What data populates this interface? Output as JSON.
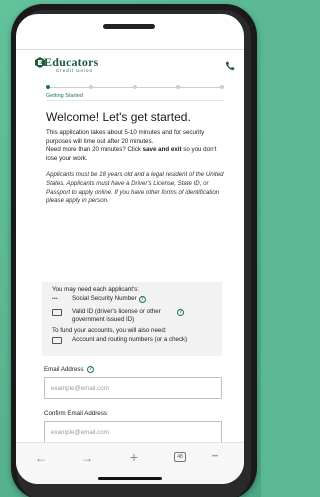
{
  "brand": {
    "name": "Educators",
    "subname": "Credit Union",
    "accent": "#1c7a4a",
    "dark_green": "#1c5c3a",
    "background": "#5cb894"
  },
  "header": {
    "phone_icon": "phone-icon"
  },
  "progress": {
    "step_label": "Getting Started",
    "total_steps": 5,
    "current_step": 1
  },
  "main": {
    "title": "Welcome! Let's get started.",
    "intro_line1": "This application takes about 5-10 minutes and for security purposes will time out after 20 minutes.",
    "intro_line2_pre": "Need more than 20 minutes? Click ",
    "intro_line2_bold": "save and exit",
    "intro_line2_post": " so you don't lose your work.",
    "eligibility": "Applicants must be 18 years old and a legal resident of the United States. Applicants must have a Driver's License, State ID, or Passport to apply online. If you have other forms of identification please apply in person."
  },
  "need_box": {
    "title": "You may need each applicant's:",
    "ssn_icon_text": "•••-",
    "ssn_label": "Social Security Number",
    "id_label": "Valid ID (driver's license or other government issued ID)",
    "fund_title": "To fund your accounts, you will also need:",
    "fund_label": "Account and routing numbers (or a check)",
    "help_glyph": "?"
  },
  "form": {
    "email_label": "Email Address",
    "email_placeholder": "example@email.com",
    "confirm_label": "Confirm Email Address",
    "confirm_placeholder": "example@email.com"
  },
  "browser": {
    "back": "←",
    "forward": "→",
    "new_tab": "+",
    "tab_count": "48",
    "more": "•••"
  }
}
